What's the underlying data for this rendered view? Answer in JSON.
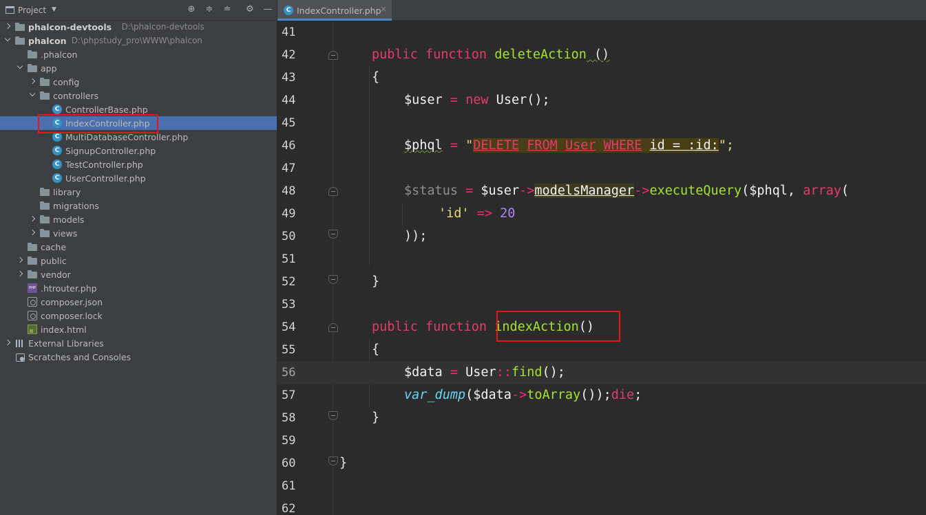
{
  "sidebar": {
    "title": "Project",
    "tree": [
      {
        "label": "phalcon-devtools",
        "path": "D:\\phalcon-devtools",
        "type": "folder",
        "arrow": "right",
        "bold": true
      },
      {
        "label": "phalcon",
        "path": "D:\\phpstudy_pro\\WWW\\phalcon",
        "type": "folder",
        "arrow": "down",
        "bold": true
      },
      {
        "label": ".phalcon",
        "type": "folder"
      },
      {
        "label": "app",
        "type": "folder",
        "arrow": "down"
      },
      {
        "label": "config",
        "type": "folder",
        "arrow": "right"
      },
      {
        "label": "controllers",
        "type": "folder",
        "arrow": "down"
      },
      {
        "label": "ControllerBase.php",
        "type": "php-class"
      },
      {
        "label": "IndexController.php",
        "type": "php-class",
        "selected": true
      },
      {
        "label": "MultiDatabaseController.php",
        "type": "php-class"
      },
      {
        "label": "SignupController.php",
        "type": "php-class"
      },
      {
        "label": "TestController.php",
        "type": "php-class"
      },
      {
        "label": "UserController.php",
        "type": "php-class"
      },
      {
        "label": "library",
        "type": "folder"
      },
      {
        "label": "migrations",
        "type": "folder"
      },
      {
        "label": "models",
        "type": "folder",
        "arrow": "right"
      },
      {
        "label": "views",
        "type": "folder",
        "arrow": "right"
      },
      {
        "label": "cache",
        "type": "folder"
      },
      {
        "label": "public",
        "type": "folder",
        "arrow": "right"
      },
      {
        "label": "vendor",
        "type": "folder",
        "arrow": "right"
      },
      {
        "label": ".htrouter.php",
        "type": "php-file"
      },
      {
        "label": "composer.json",
        "type": "json-file"
      },
      {
        "label": "composer.lock",
        "type": "json-file"
      },
      {
        "label": "index.html",
        "type": "html-file"
      },
      {
        "label": "External Libraries",
        "type": "libs",
        "arrow": "right"
      },
      {
        "label": "Scratches and Consoles",
        "type": "scratch"
      }
    ]
  },
  "editor": {
    "tab_label": "IndexController.php",
    "tab_close": "×",
    "active_line": "56",
    "lines": [
      {
        "n": "41"
      },
      {
        "n": "42"
      },
      {
        "n": "43"
      },
      {
        "n": "44"
      },
      {
        "n": "45"
      },
      {
        "n": "46"
      },
      {
        "n": "47"
      },
      {
        "n": "48"
      },
      {
        "n": "49"
      },
      {
        "n": "50"
      },
      {
        "n": "51"
      },
      {
        "n": "52"
      },
      {
        "n": "53"
      },
      {
        "n": "54"
      },
      {
        "n": "55"
      },
      {
        "n": "56"
      },
      {
        "n": "57"
      },
      {
        "n": "58"
      },
      {
        "n": "59"
      },
      {
        "n": "60"
      },
      {
        "n": "61"
      },
      {
        "n": "62"
      }
    ],
    "code": {
      "l42_public": "public",
      "l42_function": "function",
      "l42_name": "deleteAction",
      "l42_parens": " ()",
      "l43": "{",
      "l44_var": "$user",
      "l44_eq": " = ",
      "l44_new": "new",
      "l44_cls": " User();",
      "l46_var": "$phql",
      "l46_eq": " = ",
      "l46_q1": "\"",
      "l46_delete": "DELETE",
      "l46_from": "FROM",
      "l46_user": "User",
      "l46_where": "WHERE",
      "l46_rest": "id = :id:",
      "l46_q2": "\";",
      "l48_var": "$status",
      "l48_eq": " = ",
      "l48_user": "$user",
      "l48_arrow1": "->",
      "l48_member": "modelsManager",
      "l48_arrow2": "->",
      "l48_method": "executeQuery",
      "l48_args": "($phql, ",
      "l48_array": "array",
      "l48_paren": "(",
      "l49_key": "'id'",
      "l49_arrow": " => ",
      "l49_val": "20",
      "l50": "));",
      "l52": "}",
      "l54_public": "public",
      "l54_function": "function",
      "l54_name": "indexAction",
      "l54_parens": "()",
      "l55": "{",
      "l56_var": "$data",
      "l56_eq": " = ",
      "l56_cls": "User",
      "l56_dc": "::",
      "l56_method": "find",
      "l56_end": "();",
      "l57_fn": "var_dump",
      "l57_open": "(",
      "l57_var": "$data",
      "l57_arrow": "->",
      "l57_method": "toArray",
      "l57_close": "());",
      "l57_die": "die",
      "l57_end": ";",
      "l58": "}",
      "l60": "}"
    }
  },
  "colors": {
    "sidebar_bg": "#3c3f41",
    "editor_bg": "#2b2b2b",
    "selection": "#4b6eaf",
    "keyword": "#e43b6a",
    "function_name": "#a6e22e",
    "annotation_box": "#e8161b"
  }
}
